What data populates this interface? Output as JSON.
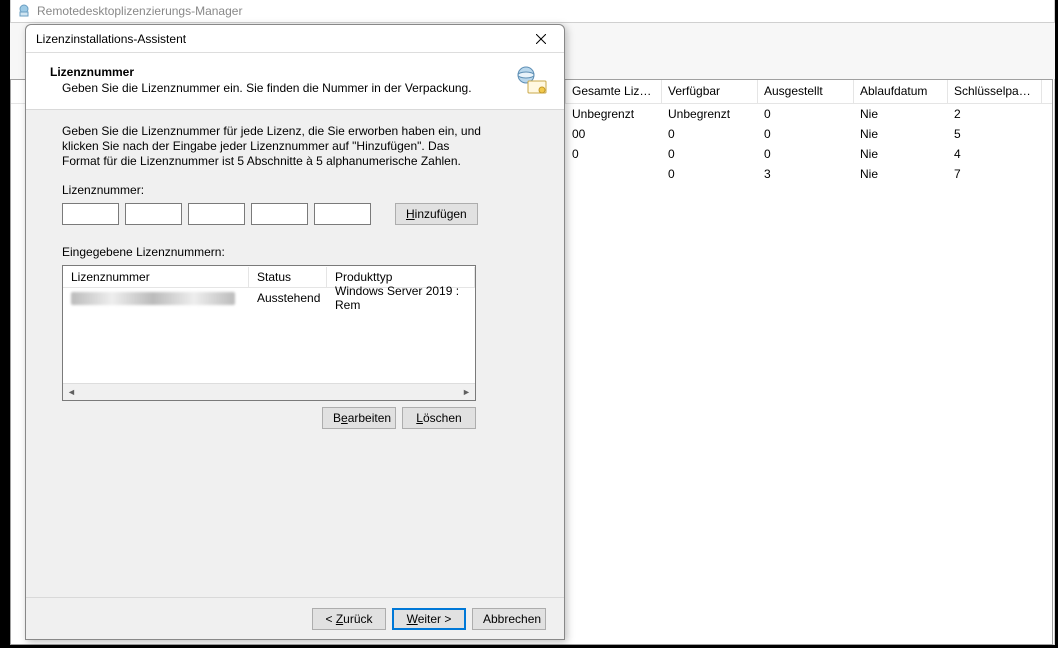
{
  "bg_window": {
    "title": "Remotedesktoplizenzierungs-Manager",
    "columns": [
      "Gesamte Lizen...",
      "Verfügbar",
      "Ausgestellt",
      "Ablaufdatum",
      "Schlüsselpaket..."
    ],
    "rows": [
      {
        "total": "Unbegrenzt",
        "available": "Unbegrenzt",
        "issued": "0",
        "expiry": "Nie",
        "pkg": "2"
      },
      {
        "total": "00",
        "available": "0",
        "issued": "0",
        "expiry": "Nie",
        "pkg": "5"
      },
      {
        "total": "0",
        "available": "0",
        "issued": "0",
        "expiry": "Nie",
        "pkg": "4"
      },
      {
        "total": "",
        "available": "0",
        "issued": "3",
        "expiry": "Nie",
        "pkg": "7"
      }
    ]
  },
  "dialog": {
    "title": "Lizenzinstallations-Assistent",
    "header": {
      "heading": "Lizenznummer",
      "sub": "Geben Sie die Lizenznummer ein. Sie finden die Nummer in der Verpackung."
    },
    "instruction": "Geben Sie die Lizenznummer für jede Lizenz, die Sie erworben haben ein, und klicken Sie nach der Eingabe jeder Lizenznummer auf \"Hinzufügen\". Das Format für die Lizenznummer ist 5 Abschnitte à 5 alphanumerische Zahlen.",
    "license_label": "Lizenznummer:",
    "add_button": "Hinzufügen",
    "entered_label": "Eingegebene Lizenznummern:",
    "list": {
      "columns": [
        "Lizenznummer",
        "Status",
        "Produkttyp"
      ],
      "rows": [
        {
          "status": "Ausstehend",
          "product": "Windows Server 2019 : Rem"
        }
      ]
    },
    "edit_button": "Bearbeiten",
    "delete_button": "Löschen",
    "back_button": "< Zurück",
    "next_button": "Weiter >",
    "cancel_button": "Abbrechen"
  }
}
